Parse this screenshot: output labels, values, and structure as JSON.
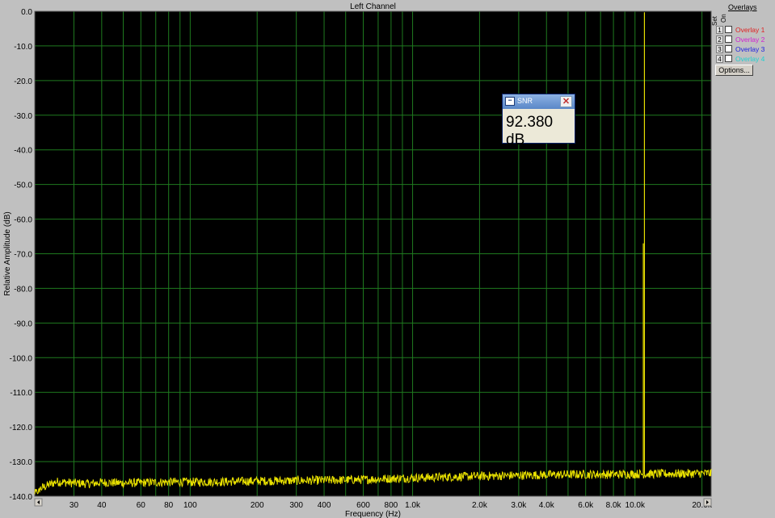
{
  "chart_data": {
    "type": "line",
    "title": "Left Channel",
    "xlabel": "Frequency (Hz)",
    "ylabel": "Relative Amplitude (dB)",
    "xscale": "log",
    "xlim": [
      20,
      22000
    ],
    "ylim": [
      -140,
      0
    ],
    "grid": true,
    "y_ticks": [
      0,
      -10,
      -20,
      -30,
      -40,
      -50,
      -60,
      -70,
      -80,
      -90,
      -100,
      -110,
      -120,
      -130,
      -140
    ],
    "y_tick_labels": [
      "0.0",
      "-10.0",
      "-20.0",
      "-30.0",
      "-40.0",
      "-50.0",
      "-60.0",
      "-70.0",
      "-80.0",
      "-90.0",
      "-100.0",
      "-110.0",
      "-120.0",
      "-130.0",
      "-140.0"
    ],
    "x_ticks": [
      30,
      40,
      60,
      80,
      100,
      200,
      300,
      400,
      600,
      800,
      1000,
      2000,
      3000,
      4000,
      6000,
      8000,
      10000,
      20000
    ],
    "x_tick_labels": [
      "30",
      "40",
      "60",
      "80",
      "100",
      "200",
      "300",
      "400",
      "600",
      "800",
      "1.0k",
      "2.0k",
      "3.0k",
      "4.0k",
      "6.0k",
      "8.0k",
      "10.0k",
      "20.0k"
    ],
    "x_grid": [
      30,
      40,
      50,
      60,
      70,
      80,
      90,
      100,
      200,
      300,
      400,
      500,
      600,
      700,
      800,
      900,
      1000,
      2000,
      3000,
      4000,
      5000,
      6000,
      7000,
      8000,
      9000,
      10000,
      20000
    ],
    "series": [
      {
        "color": "#e8e000",
        "noise_floor": [
          [
            20,
            -138.5
          ],
          [
            25,
            -135.8
          ],
          [
            30,
            -136.2
          ],
          [
            35,
            -136.4
          ],
          [
            40,
            -136.0
          ],
          [
            50,
            -136.2
          ],
          [
            60,
            -136.1
          ],
          [
            80,
            -135.9
          ],
          [
            100,
            -135.9
          ],
          [
            150,
            -135.8
          ],
          [
            200,
            -135.6
          ],
          [
            300,
            -135.5
          ],
          [
            400,
            -135.4
          ],
          [
            600,
            -135.2
          ],
          [
            800,
            -134.9
          ],
          [
            1000,
            -134.7
          ],
          [
            1500,
            -134.4
          ],
          [
            2000,
            -134.2
          ],
          [
            3000,
            -134.0
          ],
          [
            4000,
            -133.8
          ],
          [
            6000,
            -133.7
          ],
          [
            8000,
            -133.7
          ],
          [
            10000,
            -133.6
          ],
          [
            15000,
            -133.5
          ],
          [
            20000,
            -133.4
          ],
          [
            22000,
            -133.4
          ]
        ],
        "peaks": [
          {
            "freq": 11025,
            "db": -0.3
          },
          {
            "freq": 10900,
            "db": -67
          }
        ]
      }
    ]
  },
  "overlays": {
    "title": "Overlays",
    "set_label": "Set",
    "on_label": "On",
    "items": [
      {
        "num": "1",
        "label": "Overlay 1",
        "color": "#e02020"
      },
      {
        "num": "2",
        "label": "Overlay 2",
        "color": "#d020d0"
      },
      {
        "num": "3",
        "label": "Overlay 3",
        "color": "#2020e0"
      },
      {
        "num": "4",
        "label": "Overlay 4",
        "color": "#20d0d0"
      }
    ],
    "options_label": "Options..."
  },
  "snr": {
    "title": "SNR",
    "value": "92.380 dB",
    "app_icon": "app-icon",
    "close_icon": "close-icon"
  }
}
